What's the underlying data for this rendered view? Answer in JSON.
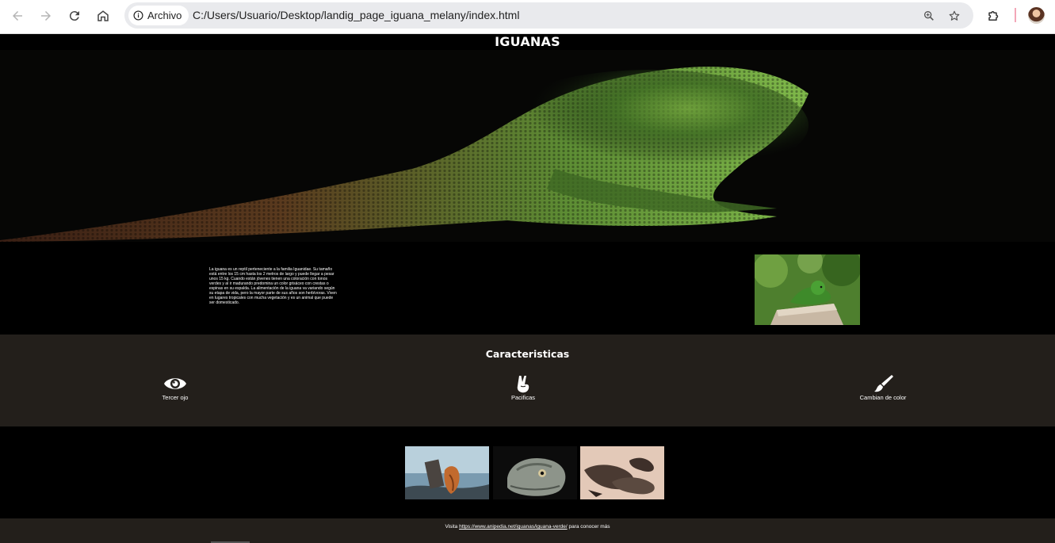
{
  "browser": {
    "security_chip_label": "Archivo",
    "url": "C:/Users/Usuario/Desktop/landig_page_iguana_melany/index.html",
    "icons": {
      "back": "arrow-left",
      "forward": "arrow-right",
      "reload": "reload",
      "home": "home",
      "info": "info-circle",
      "zoom": "magnifier",
      "bookmark": "star",
      "extensions": "puzzle-piece",
      "profile": "profile-avatar"
    }
  },
  "page": {
    "title": "IGUANAS",
    "intro_text": "La iguana es un reptil perteneciente a la familia Iguanidae. Su tamaño está entre los 15 cm hasta los 2 metros de largo y puede llegar a pesar unos 15 kg. Cuando están jóvenes tienen una coloración con tonos verdes y al ir madurando predomina un color grisáceo con crestas o espinas en su espalda. La alimentación de la iguana va variando según su etapa de vida, pero la mayor parte de sus años son herbívoras. Viven en lugares tropicales con mucha vegetación y es un animal que puede ser domesticado.",
    "features_title": "Caracteristicas",
    "features": [
      {
        "label": "Tercer ojo",
        "icon": "eye"
      },
      {
        "label": "Pacificas",
        "icon": "peace-hand"
      },
      {
        "label": "Cambian de color",
        "icon": "paintbrush"
      }
    ],
    "footer": {
      "prefix": "Visita",
      "link": "https://www.anipedia.net/iguanas/iguana-verde/",
      "suffix": "para conocer más"
    }
  },
  "colors": {
    "page_background": "#000000",
    "section_background": "#231f1b",
    "chrome_background": "#ffffff",
    "omnibox_background": "#e9eaed"
  }
}
